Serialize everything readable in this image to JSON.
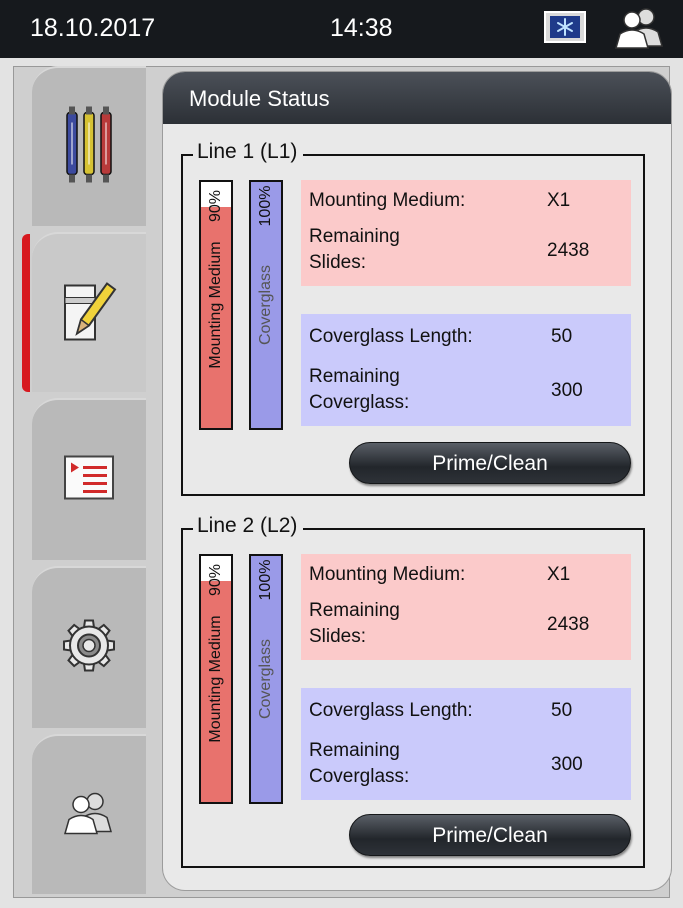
{
  "status_bar": {
    "date": "18.10.2017",
    "time": "14:38",
    "icons": [
      "cooling-mode-icon",
      "user-icon"
    ]
  },
  "sidebar": {
    "items": [
      {
        "icon": "reagent-bottles-icon",
        "active": false
      },
      {
        "icon": "module-status-icon",
        "active": true
      },
      {
        "icon": "parameter-list-icon",
        "active": false
      },
      {
        "icon": "settings-gear-icon",
        "active": false
      },
      {
        "icon": "user-settings-icon",
        "active": false
      }
    ]
  },
  "panel": {
    "title": "Module Status"
  },
  "lines": [
    {
      "title": "Line 1 (L1)",
      "mounting_gauge": {
        "label": "Mounting Medium",
        "percent_text": "90%",
        "level": 0.9,
        "color": "#e8726d"
      },
      "coverglass_gauge": {
        "label": "Coverglass",
        "percent_text": "100%",
        "level": 1.0,
        "color": "#9a9ae8"
      },
      "medium_info": {
        "mounting_label": "Mounting Medium:",
        "mounting_value": "X1",
        "slides_label_1": "Remaining",
        "slides_label_2": "Slides:",
        "slides_value": "2438"
      },
      "coverglass_info": {
        "length_label": "Coverglass Length:",
        "length_value": "50",
        "remaining_label_1": "Remaining",
        "remaining_label_2": "Coverglass:",
        "remaining_value": "300"
      },
      "button_label": "Prime/Clean"
    },
    {
      "title": "Line 2 (L2)",
      "mounting_gauge": {
        "label": "Mounting Medium",
        "percent_text": "90%",
        "level": 0.9,
        "color": "#e8726d"
      },
      "coverglass_gauge": {
        "label": "Coverglass",
        "percent_text": "100%",
        "level": 1.0,
        "color": "#9a9ae8"
      },
      "medium_info": {
        "mounting_label": "Mounting Medium:",
        "mounting_value": "X1",
        "slides_label_1": "Remaining",
        "slides_label_2": "Slides:",
        "slides_value": "2438"
      },
      "coverglass_info": {
        "length_label": "Coverglass Length:",
        "length_value": "50",
        "remaining_label_1": "Remaining",
        "remaining_label_2": "Coverglass:",
        "remaining_value": "300"
      },
      "button_label": "Prime/Clean"
    }
  ],
  "colors": {
    "medium_box": "#fbcaca",
    "coverglass_box": "#cacafb",
    "active_tab_marker": "#d7191f"
  }
}
